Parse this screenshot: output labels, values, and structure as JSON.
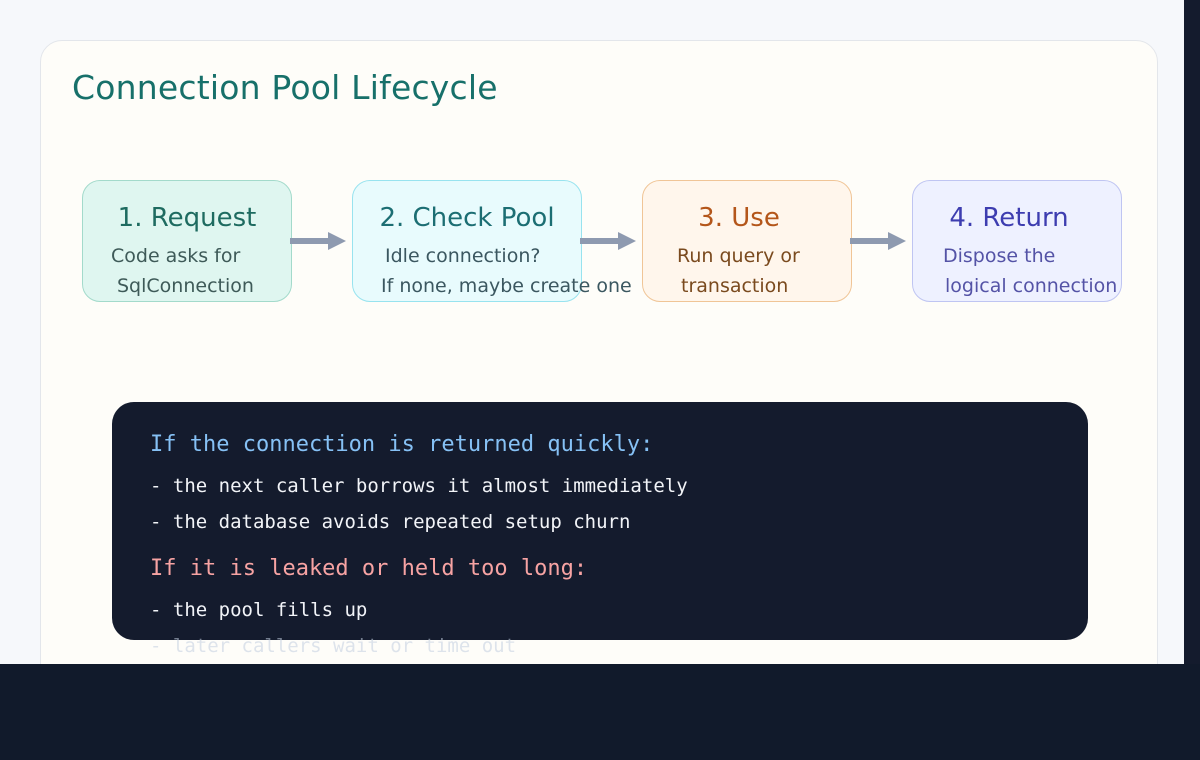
{
  "title": "Connection Pool Lifecycle",
  "steps": [
    {
      "title": "1. Request",
      "lines": [
        "Code asks for",
        "SqlConnection"
      ]
    },
    {
      "title": "2. Check Pool",
      "lines": [
        "Idle connection?",
        "If none, maybe create one"
      ]
    },
    {
      "title": "3. Use",
      "lines": [
        "Run query or",
        "transaction"
      ]
    },
    {
      "title": "4. Return",
      "lines": [
        "Dispose the",
        "logical connection"
      ]
    }
  ],
  "code": {
    "heading_good": "If the connection is returned quickly:",
    "good_lines": [
      "- the next caller borrows it almost immediately",
      "- the database avoids repeated setup churn"
    ],
    "heading_bad": "If it is leaked or held too long:",
    "bad_lines": [
      "- the pool fills up",
      "- later callers wait or time out"
    ]
  },
  "colors": {
    "title": "#17706a",
    "arrow": "#8e9ab0",
    "code_bg": "#141b2d",
    "good_heading": "#86c1f5",
    "bad_heading": "#f7a3a3"
  },
  "icons": [
    "arrow-right-icon"
  ]
}
